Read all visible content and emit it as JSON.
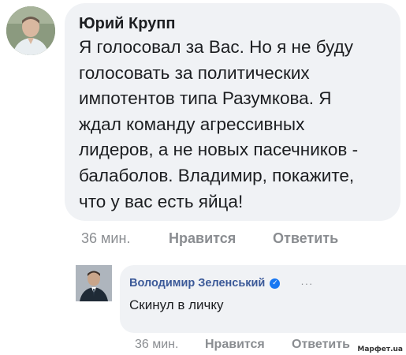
{
  "comment1": {
    "author": "Юрий Крупп",
    "lines": [
      "Я голосовал за Вас. Но я не буду",
      "голосовать за политических",
      "импотентов типа Разумкова. Я",
      "ждал команду агрессивных",
      "лидеров, а не новых пасечников -",
      "балаболов. Владимир, покажите,",
      "что у вас есть яйца!"
    ],
    "time": "36 мин.",
    "like_label": "Нравится",
    "reply_label": "Ответить"
  },
  "comment2": {
    "author": "Володимир Зеленський",
    "verified_icon": "✓",
    "more_label": "···",
    "text": "Скинул в личку",
    "time": "36 мин.",
    "like_label": "Нравится",
    "reply_label": "Ответить"
  },
  "watermark": "Марфет.ua",
  "colors": {
    "bubble": "#f0f2f5",
    "author_link": "#3b5998",
    "meta_text": "#8a8d91",
    "verified": "#1877f2"
  }
}
